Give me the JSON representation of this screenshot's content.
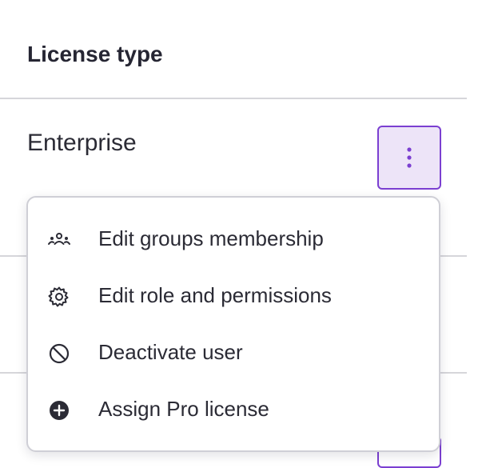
{
  "table": {
    "column_header": "License type",
    "rows": [
      {
        "license": "Enterprise"
      }
    ]
  },
  "row_actions_menu": {
    "items": [
      {
        "label": "Edit groups membership",
        "icon": "groups-icon"
      },
      {
        "label": "Edit role and permissions",
        "icon": "gear-icon"
      },
      {
        "label": "Deactivate user",
        "icon": "block-icon"
      },
      {
        "label": "Assign Pro license",
        "icon": "plus-circle-icon"
      }
    ]
  },
  "colors": {
    "accent": "#7b3fd1",
    "accent_bg": "#ede4f8",
    "text": "#2b2b35",
    "divider": "#d6d6da"
  }
}
